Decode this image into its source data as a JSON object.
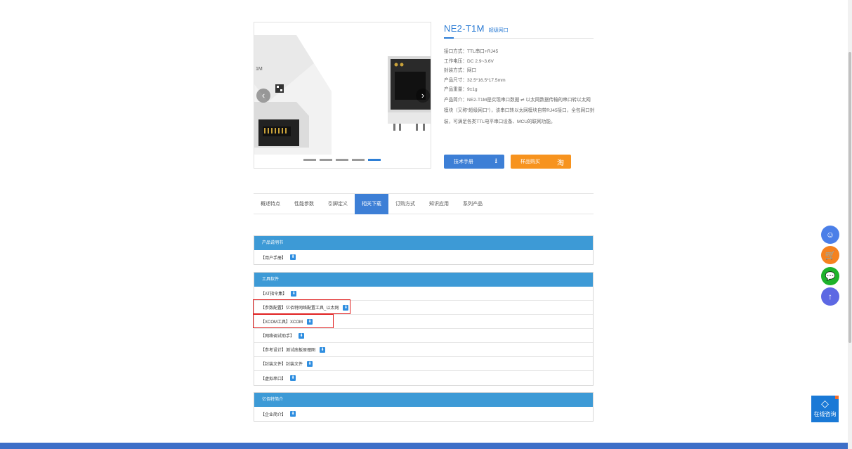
{
  "product": {
    "name": "NE2-T1M",
    "subtitle": "超级网口",
    "specs": [
      "接口方式：TTL串口+RJ45",
      "工作电压：DC 2.9~3.6V",
      "封装方式：网口",
      "产品尺寸：32.5*16.5*17.5mm",
      "产品重量：9±1g"
    ],
    "description": "产品简介：NE2-T1M是实现串口数据 ⇌ 以太网数据传输的串口转以太网模块（又称“超级网口”），该串口转以太网模块自带RJ45接口，全包网口封装，可满足各类TTL电平串口设备、MCU的联网功能。",
    "buttons": {
      "manual": "技术手册",
      "buy": "样品购买"
    }
  },
  "gallery": {
    "prev": "‹",
    "next": "›",
    "slides": 5,
    "active_slide": 5
  },
  "tabs": [
    {
      "label": "概述特点",
      "active": false
    },
    {
      "label": "性能参数",
      "active": false
    },
    {
      "label": "引脚定义",
      "active": false
    },
    {
      "label": "相关下载",
      "active": true
    },
    {
      "label": "订购方式",
      "active": false
    },
    {
      "label": "知识应用",
      "active": false
    },
    {
      "label": "系列产品",
      "active": false
    }
  ],
  "sections": [
    {
      "title": "产品说明书",
      "items": [
        "【用户手册】"
      ]
    },
    {
      "title": "工具软件",
      "items": [
        "【AT指令集】",
        "【参数配置】亿佰特网络配置工具_以太网",
        "【XCOM工具】XCOM",
        "【网络调试助手】",
        "【参考设计】测试底板原理图",
        "【封装文件】封装文件",
        "【虚拟串口】"
      ]
    },
    {
      "title": "亿佰特简介",
      "items": [
        "【企业简介】"
      ]
    }
  ],
  "float": {
    "consult_label": "在线咨询"
  }
}
